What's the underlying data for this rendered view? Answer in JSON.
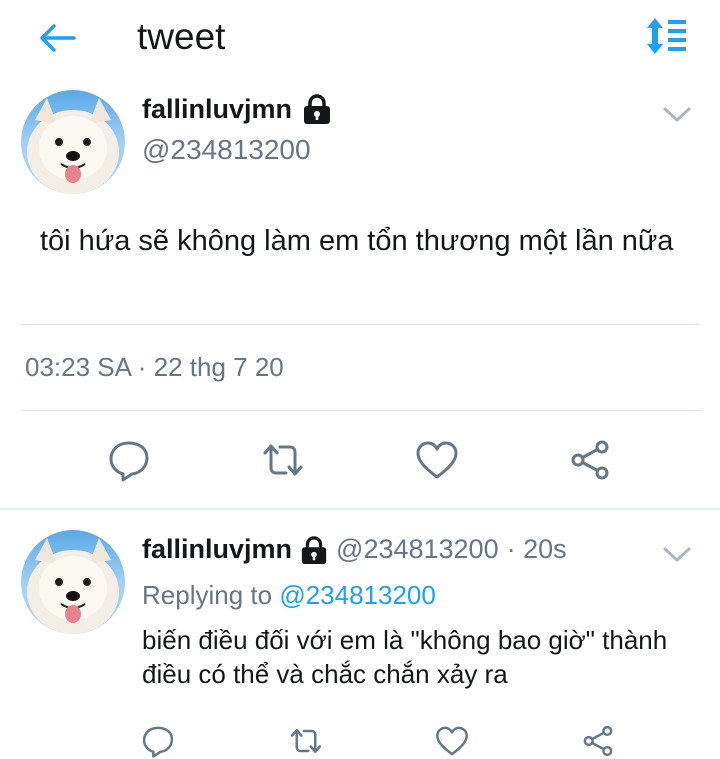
{
  "header": {
    "title": "tweet",
    "back_icon": "arrow-left-icon",
    "sort_icon": "sort-lines-icon",
    "accent_color": "#1da1f2"
  },
  "main_tweet": {
    "display_name": "fallinluvjmn",
    "handle": "@234813200",
    "protected_icon": "lock-icon",
    "text": "tôi hứa sẽ không làm em tổn thương một lần nữa",
    "timestamp": "03:23 SA · 22 thg 7 20",
    "actions": [
      "reply-icon",
      "retweet-icon",
      "like-icon",
      "share-icon"
    ]
  },
  "reply_tweet": {
    "display_name": "fallinluvjmn",
    "handle": "@234813200",
    "time_ago": "· 20s",
    "replying_prefix": "Replying to",
    "replying_to": "@234813200",
    "text": "biến điều đối với em là \"không bao giờ\" thành điều có thể và chắc chắn xảy ra",
    "actions": [
      "reply-icon",
      "retweet-icon",
      "like-icon",
      "share-icon"
    ]
  }
}
